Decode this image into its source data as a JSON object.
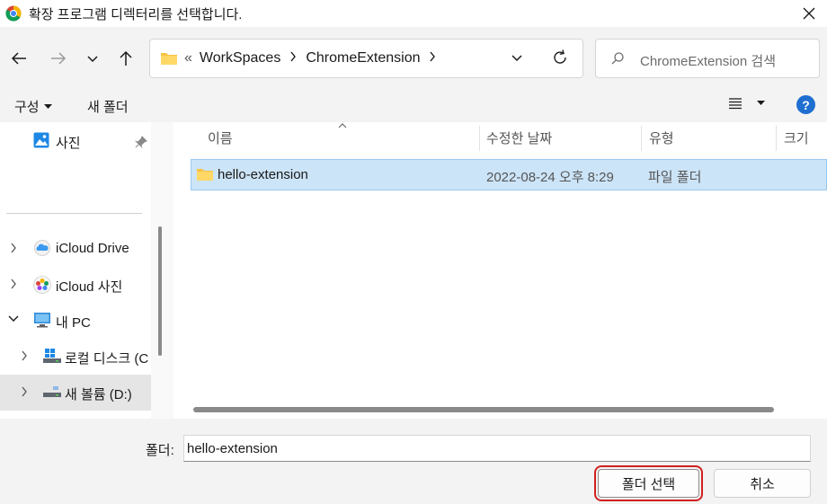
{
  "window": {
    "title": "확장 프로그램 디렉터리를 선택합니다."
  },
  "address_bar": {
    "overflow": "«",
    "crumbs": [
      "WorkSpaces",
      "ChromeExtension"
    ]
  },
  "search": {
    "placeholder": "ChromeExtension 검색"
  },
  "toolbar": {
    "organize_label": "구성",
    "new_folder_label": "새 폴더",
    "help_label": "?"
  },
  "sidebar": {
    "items": [
      {
        "label": "사진",
        "icon": "photos-icon"
      },
      {
        "label": "iCloud Drive",
        "icon": "icloud-drive-icon"
      },
      {
        "label": "iCloud 사진",
        "icon": "icloud-photos-icon"
      },
      {
        "label": "내 PC",
        "icon": "this-pc-icon"
      },
      {
        "label": "로컬 디스크 (C",
        "icon": "local-disk-icon"
      },
      {
        "label": "새 볼륨 (D:)",
        "icon": "volume-icon",
        "selected": true
      }
    ]
  },
  "file_list": {
    "columns": [
      "이름",
      "수정한 날짜",
      "유형",
      "크기"
    ],
    "rows": [
      {
        "name": "hello-extension",
        "modified": "2022-08-24 오후 8:29",
        "type": "파일 폴더",
        "size": ""
      }
    ]
  },
  "footer": {
    "folder_label": "폴더:",
    "folder_value": "hello-extension",
    "select_button": "폴더 선택",
    "cancel_button": "취소"
  },
  "colors": {
    "selection_bg": "#cce4f7",
    "help_blue": "#1f6fd0",
    "highlight_outline": "#d02020"
  }
}
